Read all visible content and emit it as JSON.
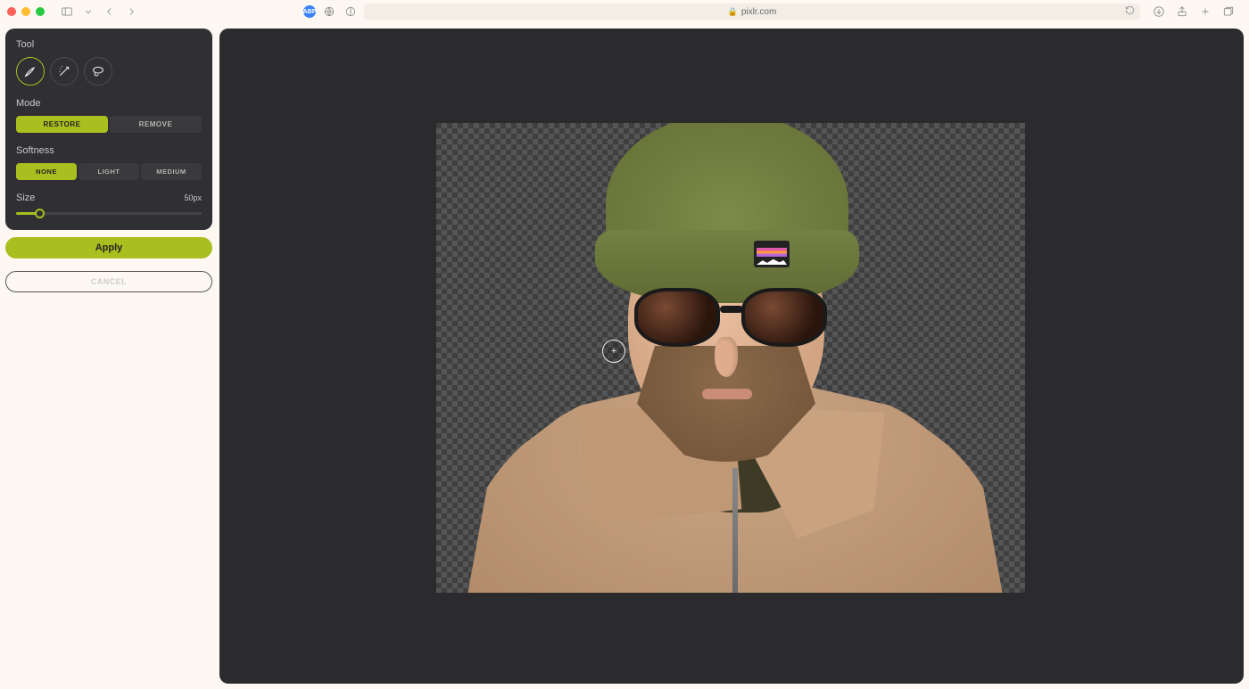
{
  "browser": {
    "url_host": "pixlr.com"
  },
  "panel": {
    "tool_label": "Tool",
    "mode_label": "Mode",
    "mode_options": {
      "restore": "RESTORE",
      "remove": "REMOVE"
    },
    "softness_label": "Softness",
    "softness_options": {
      "none": "NONE",
      "light": "LIGHT",
      "medium": "MEDIUM"
    },
    "size_label": "Size",
    "size_value": "50px",
    "size_percent": 12
  },
  "actions": {
    "apply": "Apply",
    "cancel": "CANCEL"
  },
  "colors": {
    "accent": "#a9bf1f"
  }
}
